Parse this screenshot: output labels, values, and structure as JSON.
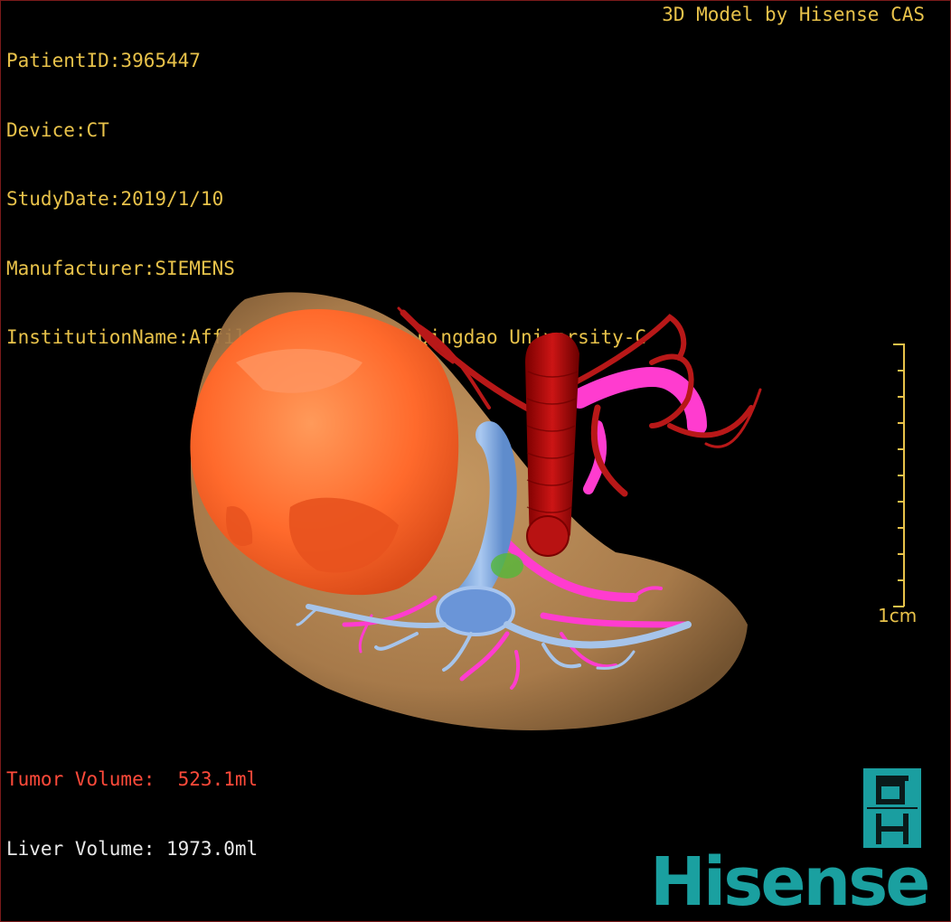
{
  "patient_info": {
    "patient_id": "PatientID:3965447",
    "device": "Device:CT",
    "study_date": "StudyDate:2019/1/10",
    "manufacturer": "Manufacturer:SIEMENS",
    "institution": "InstitutionName:Affiliated Hospital Qingdao University-C"
  },
  "header": {
    "model_credit": "3D Model by Hisense CAS"
  },
  "scale": {
    "label": "1cm",
    "ticks": 11
  },
  "volumes": {
    "tumor": "Tumor Volume:  523.1ml",
    "liver": "Liver Volume: 1973.0ml"
  },
  "logo": {
    "wordmark": "Hisense",
    "emblem_letters": "dH"
  },
  "colors": {
    "text_info": "#e8c24a",
    "tumor_text": "#ff4a3a",
    "liver": "#c8975a",
    "tumor": "#ff6a2a",
    "artery": "#b01010",
    "portal_vein": "#ff3ccf",
    "hepatic_vein": "#8fb6e6",
    "brand": "#1aa0a0"
  }
}
